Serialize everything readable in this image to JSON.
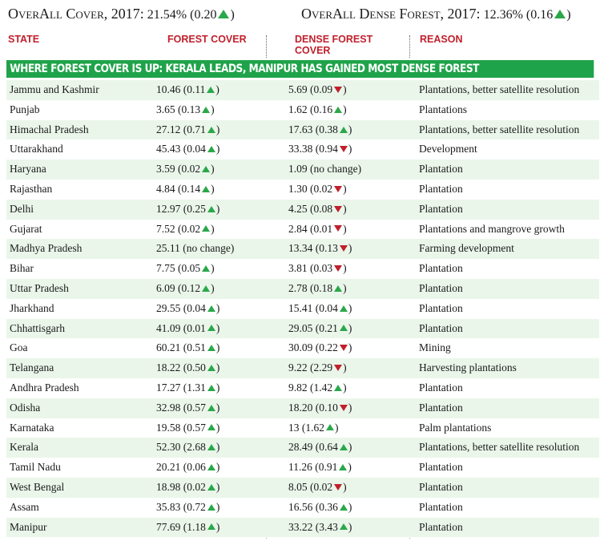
{
  "summary": {
    "cover_label": "OverAll Cover, 2017:",
    "cover_value": "21.54% (0.20",
    "cover_close": ")",
    "dense_label": "OverAll Dense Forest, 2017:",
    "dense_value": "12.36% (0.16",
    "dense_close": ")"
  },
  "columns": {
    "state": "STATE",
    "forest_cover": "FOREST COVER",
    "dense_forest_cover": "DENSE FOREST COVER",
    "reason": "REASON"
  },
  "banner": "Where forest cover is up: Kerala leads, Manipur has gained most dense forest",
  "colors": {
    "up": "#2aa84a",
    "down": "#c0202c",
    "banner": "#1fa34a",
    "header": "#c0202c",
    "row_tint": "#eaf6ea"
  },
  "rows": [
    {
      "state": "Jammu and Kashmir",
      "forest": "10.46 (0.11",
      "forest_dir": "up",
      "dense": "5.69 (0.09",
      "dense_dir": "down",
      "reason": "Plantations, better satellite resolution"
    },
    {
      "state": "Punjab",
      "forest": "3.65 (0.13",
      "forest_dir": "up",
      "dense": "1.62 (0.16",
      "dense_dir": "up",
      "reason": "Plantations"
    },
    {
      "state": "Himachal Pradesh",
      "forest": "27.12 (0.71",
      "forest_dir": "up",
      "dense": "17.63 (0.38",
      "dense_dir": "up",
      "reason": "Plantations, better satellite resolution"
    },
    {
      "state": "Uttarakhand",
      "forest": "45.43 (0.04",
      "forest_dir": "up",
      "dense": "33.38 (0.94",
      "dense_dir": "down",
      "reason": "Development"
    },
    {
      "state": "Haryana",
      "forest": "3.59 (0.02",
      "forest_dir": "up",
      "dense": "1.09 (no change)",
      "dense_dir": "none",
      "reason": "Plantation"
    },
    {
      "state": "Rajasthan",
      "forest": "4.84 (0.14",
      "forest_dir": "up",
      "dense": "1.30 (0.02",
      "dense_dir": "down",
      "reason": "Plantation"
    },
    {
      "state": "Delhi",
      "forest": "12.97 (0.25",
      "forest_dir": "up",
      "dense": "4.25 (0.08",
      "dense_dir": "down",
      "reason": "Plantation"
    },
    {
      "state": "Gujarat",
      "forest": "7.52 (0.02",
      "forest_dir": "up",
      "dense": "2.84 (0.01",
      "dense_dir": "down",
      "reason": "Plantations and mangrove growth"
    },
    {
      "state": "Madhya Pradesh",
      "forest": "25.11 (no change)",
      "forest_dir": "none",
      "dense": "13.34 (0.13",
      "dense_dir": "down",
      "reason": "Farming development"
    },
    {
      "state": "Bihar",
      "forest": "7.75 (0.05",
      "forest_dir": "up",
      "dense": "3.81 (0.03",
      "dense_dir": "down",
      "reason": "Plantation"
    },
    {
      "state": "Uttar Pradesh",
      "forest": "6.09 (0.12",
      "forest_dir": "up",
      "dense": "2.78 (0.18",
      "dense_dir": "up",
      "reason": "Plantation"
    },
    {
      "state": "Jharkhand",
      "forest": "29.55 (0.04",
      "forest_dir": "up",
      "dense": "15.41 (0.04",
      "dense_dir": "up",
      "reason": "Plantation"
    },
    {
      "state": "Chhattisgarh",
      "forest": "41.09 (0.01",
      "forest_dir": "up",
      "dense": "29.05 (0.21",
      "dense_dir": "up",
      "reason": "Plantation"
    },
    {
      "state": "Goa",
      "forest": "60.21 (0.51",
      "forest_dir": "up",
      "dense": "30.09 (0.22",
      "dense_dir": "down",
      "reason": "Mining"
    },
    {
      "state": "Telangana",
      "forest": "18.22 (0.50",
      "forest_dir": "up",
      "dense": "9.22 (2.29",
      "dense_dir": "down",
      "reason": "Harvesting plantations"
    },
    {
      "state": "Andhra Pradesh",
      "forest": "17.27 (1.31",
      "forest_dir": "up",
      "dense": "9.82 (1.42",
      "dense_dir": "up",
      "reason": "Plantation"
    },
    {
      "state": "Odisha",
      "forest": "32.98 (0.57",
      "forest_dir": "up",
      "dense": "18.20 (0.10",
      "dense_dir": "down",
      "reason": "Plantation"
    },
    {
      "state": "Karnataka",
      "forest": "19.58 (0.57",
      "forest_dir": "up",
      "dense": "13 (1.62",
      "dense_dir": "up",
      "reason": "Palm plantations"
    },
    {
      "state": "Kerala",
      "forest": "52.30 (2.68",
      "forest_dir": "up",
      "dense": "28.49 (0.64",
      "dense_dir": "up",
      "reason": "Plantations, better satellite resolution"
    },
    {
      "state": "Tamil Nadu",
      "forest": "20.21 (0.06",
      "forest_dir": "up",
      "dense": "11.26 (0.91",
      "dense_dir": "up",
      "reason": "Plantation"
    },
    {
      "state": "West Bengal",
      "forest": "18.98 (0.02",
      "forest_dir": "up",
      "dense": "8.05 (0.02",
      "dense_dir": "down",
      "reason": "Plantation"
    },
    {
      "state": "Assam",
      "forest": "35.83 (0.72",
      "forest_dir": "up",
      "dense": "16.56 (0.36",
      "dense_dir": "up",
      "reason": "Plantation"
    },
    {
      "state": "Manipur",
      "forest": "77.69 (1.18",
      "forest_dir": "up",
      "dense": "33.22 (3.43",
      "dense_dir": "up",
      "reason": "Plantation"
    }
  ]
}
